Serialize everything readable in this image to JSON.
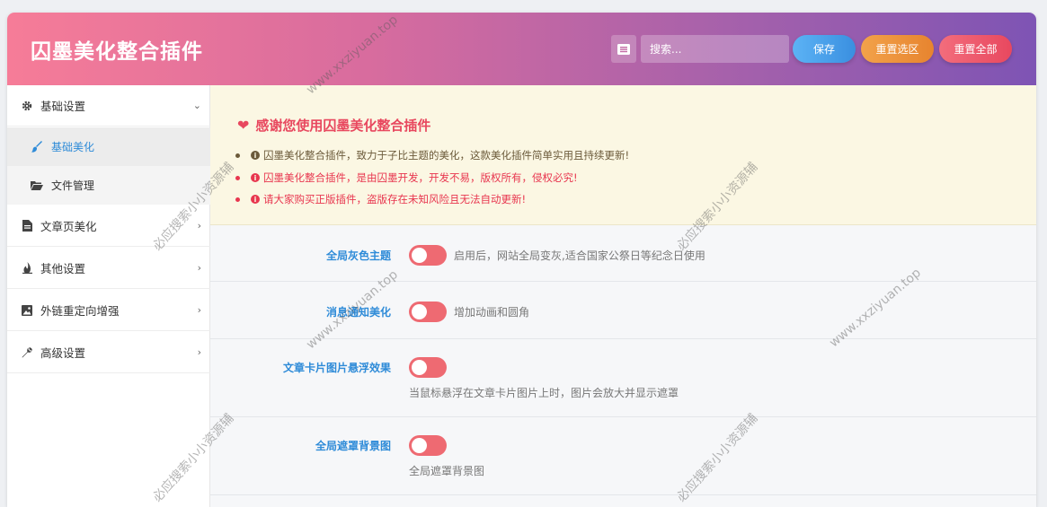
{
  "header": {
    "title": "囚墨美化整合插件",
    "search_placeholder": "搜索...",
    "buttons": {
      "save": "保存",
      "reset_selection": "重置选区",
      "reset_all": "重置全部"
    }
  },
  "sidebar": {
    "items": [
      {
        "label": "基础设置",
        "icon": "gear-icon",
        "chevron": "⌄"
      },
      {
        "label": "基础美化",
        "icon": "brush-icon"
      },
      {
        "label": "文件管理",
        "icon": "folder-icon"
      },
      {
        "label": "文章页美化",
        "icon": "file-icon",
        "chevron": "›"
      },
      {
        "label": "其他设置",
        "icon": "fire-icon",
        "chevron": "›"
      },
      {
        "label": "外链重定向增强",
        "icon": "image-icon",
        "chevron": "›"
      },
      {
        "label": "高级设置",
        "icon": "wrench-icon",
        "chevron": "›"
      }
    ]
  },
  "notice": {
    "title": "感谢您使用囚墨美化整合插件",
    "lines": [
      "囚墨美化整合插件，致力于子比主题的美化，这款美化插件简单实用且持续更新!",
      "囚墨美化整合插件，是由囚墨开发，开发不易，版权所有，侵权必究!",
      "请大家购买正版插件，盗版存在未知风险且无法自动更新!"
    ],
    "colors": {
      "dark": "#6b5a3a",
      "red": "#e8364f"
    }
  },
  "settings": [
    {
      "label": "全局灰色主题",
      "description": "启用后，网站全局变灰,适合国家公祭日等纪念日使用",
      "enabled": false
    },
    {
      "label": "消息通知美化",
      "description": "增加动画和圆角",
      "enabled": false
    },
    {
      "label": "文章卡片图片悬浮效果",
      "description": "当鼠标悬浮在文章卡片图片上时，图片会放大并显示遮罩",
      "enabled": false
    },
    {
      "label": "全局遮罩背景图",
      "description": "全局遮罩背景图",
      "enabled": false
    }
  ],
  "watermarks": {
    "url": "www.xxziyuan.top",
    "search": "必应搜索小小资源辅"
  },
  "colors": {
    "accent": "#2e8bd8",
    "toggle_off": "#ee6a72",
    "header_start": "#f67c98",
    "header_end": "#7e54b4"
  }
}
